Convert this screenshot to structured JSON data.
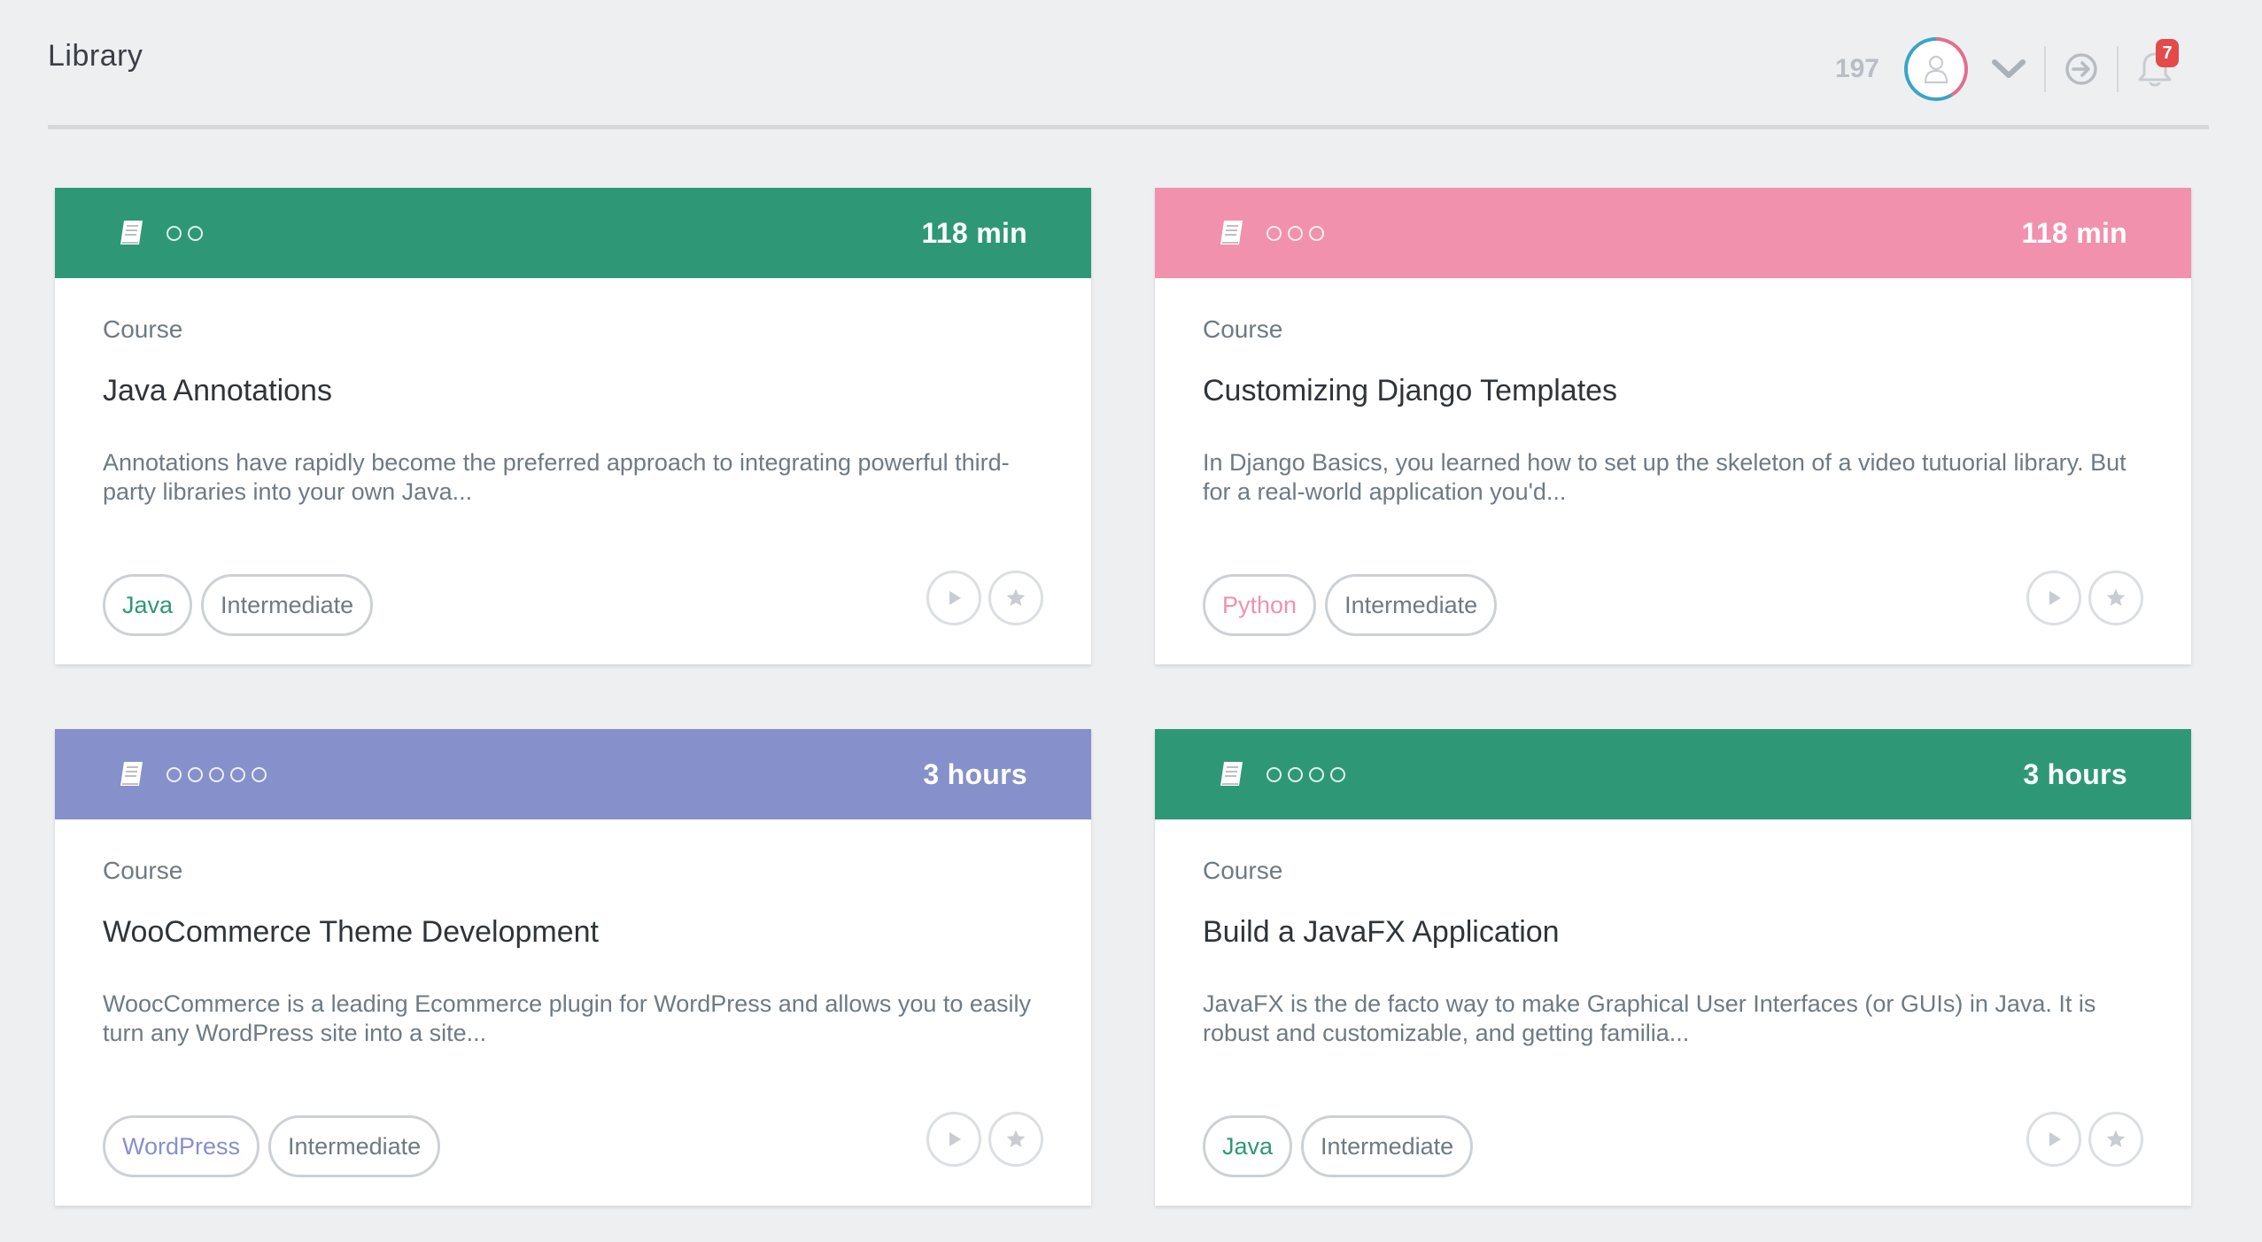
{
  "header": {
    "title": "Library",
    "points": "197",
    "notifications_count": "7",
    "icons": [
      "user-icon",
      "chevron-down-icon",
      "signout-icon",
      "bell-icon"
    ]
  },
  "colors": {
    "green": "#2e9876",
    "pink": "#f191ae",
    "purple": "#8690ca",
    "text_muted": "#6f7a82",
    "badge": "#e34b4b"
  },
  "cards": [
    {
      "header_color": "#2e9876",
      "dots": 2,
      "duration": "118 min",
      "type": "Course",
      "title": "Java Annotations",
      "description": "Annotations have rapidly become the preferred approach to integrating powerful third-party libraries into your own Java...",
      "tags": [
        {
          "label": "Java",
          "color": "#2e9876"
        },
        {
          "label": "Intermediate",
          "color": "#6f7a82"
        }
      ]
    },
    {
      "header_color": "#f191ae",
      "dots": 3,
      "duration": "118 min",
      "type": "Course",
      "title": "Customizing Django Templates",
      "description": "In Django Basics, you learned how to set up the skeleton of a video tutuorial library. But for a real-world application you'd...",
      "tags": [
        {
          "label": "Python",
          "color": "#f191ae"
        },
        {
          "label": "Intermediate",
          "color": "#6f7a82"
        }
      ]
    },
    {
      "header_color": "#8690ca",
      "dots": 5,
      "duration": "3 hours",
      "type": "Course",
      "title": "WooCommerce Theme Development",
      "description": "WoocCommerce is a leading Ecommerce plugin for WordPress and allows you to easily turn any WordPress site into a site...",
      "tags": [
        {
          "label": "WordPress",
          "color": "#8690ca"
        },
        {
          "label": "Intermediate",
          "color": "#6f7a82"
        }
      ]
    },
    {
      "header_color": "#2e9876",
      "dots": 4,
      "duration": "3 hours",
      "type": "Course",
      "title": "Build a JavaFX Application",
      "description": "JavaFX is the de facto way to make Graphical User Interfaces (or GUIs) in Java. It is robust and customizable, and getting familia...",
      "tags": [
        {
          "label": "Java",
          "color": "#2e9876"
        },
        {
          "label": "Intermediate",
          "color": "#6f7a82"
        }
      ]
    }
  ]
}
